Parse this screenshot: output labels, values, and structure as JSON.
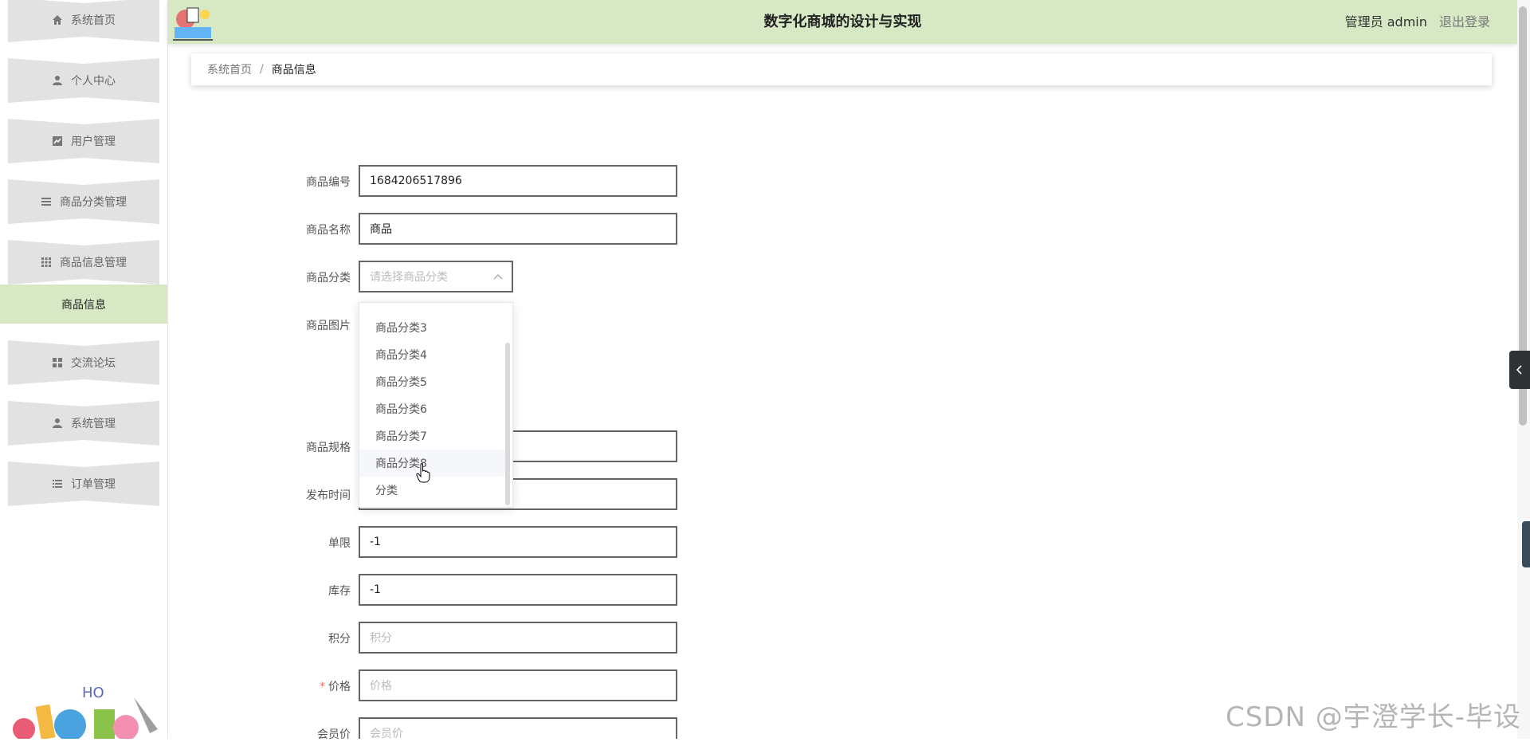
{
  "sidebar": {
    "items": [
      {
        "label": "系统首页",
        "icon": "home-icon"
      },
      {
        "label": "个人中心",
        "icon": "user-icon"
      },
      {
        "label": "用户管理",
        "icon": "chart-icon"
      },
      {
        "label": "商品分类管理",
        "icon": "list-icon"
      },
      {
        "label": "商品信息管理",
        "icon": "grid-icon"
      },
      {
        "label": "交流论坛",
        "icon": "apps-icon"
      },
      {
        "label": "系统管理",
        "icon": "user-icon"
      },
      {
        "label": "订单管理",
        "icon": "list-icon"
      }
    ],
    "active_sub": "商品信息"
  },
  "header": {
    "title": "数字化商城的设计与实现",
    "user": "管理员 admin",
    "logout": "退出登录"
  },
  "breadcrumb": {
    "home": "系统首页",
    "separator": "/",
    "current": "商品信息"
  },
  "form": {
    "code_label": "商品编号",
    "code_value": "1684206517896",
    "name_label": "商品名称",
    "name_value": "商品",
    "category_label": "商品分类",
    "category_placeholder": "请选择商品分类",
    "image_label": "商品图片",
    "spec_label": "商品规格",
    "publish_label": "发布时间",
    "limit_label": "单限",
    "limit_value": "-1",
    "stock_label": "库存",
    "stock_value": "-1",
    "points_label": "积分",
    "points_placeholder": "积分",
    "price_label": "价格",
    "price_placeholder": "价格",
    "member_price_label": "会员价",
    "member_price_placeholder": "会员价"
  },
  "dropdown": {
    "options": [
      "商品分类3",
      "商品分类4",
      "商品分类5",
      "商品分类6",
      "商品分类7",
      "商品分类8",
      "分类"
    ],
    "hovered_option": "商品分类8"
  },
  "watermark": "CSDN @宇澄学长-毕设",
  "colors": {
    "header_bg": "#d6e8c4",
    "active_sub_bg": "#d6e8c4",
    "menu_bg": "#e2e2e2",
    "required": "#f56c6c"
  }
}
